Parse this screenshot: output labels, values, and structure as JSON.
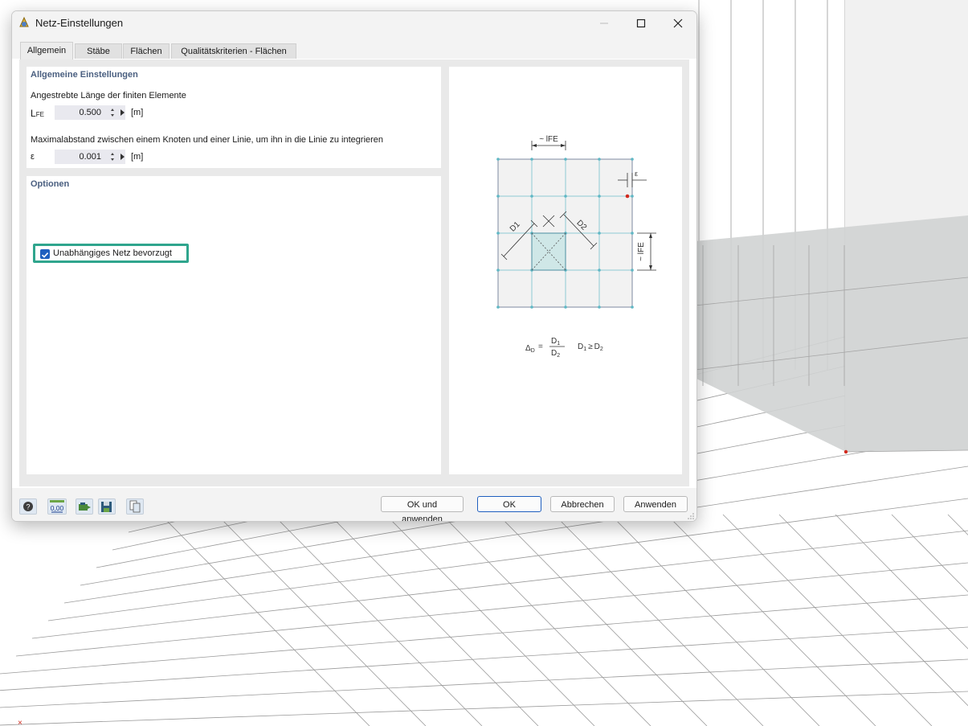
{
  "window": {
    "title": "Netz-Einstellungen"
  },
  "tabs": [
    {
      "label": "Allgemein",
      "active": true
    },
    {
      "label": "Stäbe"
    },
    {
      "label": "Flächen"
    },
    {
      "label": "Qualitätskriterien - Flächen"
    }
  ],
  "general": {
    "section_title": "Allgemeine Einstellungen",
    "fe_length": {
      "label": "Angestrebte Länge der finiten Elemente",
      "symbol_main": "L",
      "symbol_sub": "FE",
      "value": "0.500",
      "unit": "[m]"
    },
    "max_distance": {
      "label": "Maximalabstand zwischen einem Knoten und einer Linie, um ihn in die Linie zu integrieren",
      "symbol": "ε",
      "value": "0.001",
      "unit": "[m]"
    }
  },
  "options": {
    "section_title": "Optionen",
    "independent_mesh": {
      "label": "Unabhängiges Netz bevorzugt",
      "checked": true
    }
  },
  "diagram": {
    "top_dim": "~ lFE",
    "side_dim": "~ lFE",
    "eps": "ε",
    "d1": "D1",
    "d2": "D2",
    "delta": "Δ",
    "delta_sub": "D",
    "eq": "=",
    "frac_num": "D",
    "frac_num_sub": "1",
    "frac_den": "D",
    "frac_den_sub": "2",
    "cond_a": "D",
    "cond_a_sub": "1",
    "cond_op": "≥",
    "cond_b": "D",
    "cond_b_sub": "2"
  },
  "buttons": {
    "ok_apply": "OK und anwenden",
    "ok": "OK",
    "cancel": "Abbrechen",
    "apply": "Anwenden"
  },
  "footer_icons": {
    "decimal_icon_text": "0,00"
  },
  "colors": {
    "accent": "#1f5fbf",
    "highlight": "#2fa58d",
    "section_title": "#4a5f80",
    "mesh_node": "#5fb7c4",
    "node_red": "#d22a1e"
  }
}
